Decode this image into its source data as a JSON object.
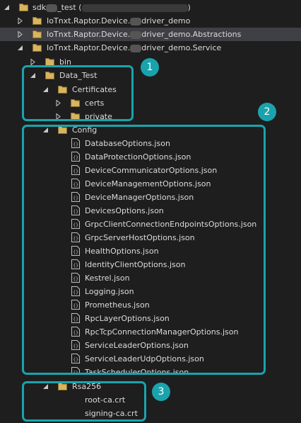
{
  "root": {
    "label_prefix": "sdk",
    "label_mid": "_test (",
    "label_end": ")"
  },
  "projects": [
    {
      "label_start": "IoTnxt.Raptor.Device.",
      "label_end": "driver_demo"
    },
    {
      "label_start": "IoTnxt.Raptor.Device.",
      "label_end": "driver_demo.Abstractions"
    },
    {
      "label_start": "IoTnxt.Raptor.Device.",
      "label_end": "driver_demo.Service"
    }
  ],
  "service_children": {
    "bin": "bin",
    "data_test": "Data_Test",
    "certificates": "Certificates",
    "certs": "certs",
    "private": "private",
    "config": "Config",
    "config_files": [
      "DatabaseOptions.json",
      "DataProtectionOptions.json",
      "DeviceCommunicatorOptions.json",
      "DeviceManagementOptions.json",
      "DeviceManagerOptions.json",
      "DevicesOptions.json",
      "GrpcClientConnectionEndpointsOptions.json",
      "GrpcServerHostOptions.json",
      "HealthOptions.json",
      "IdentityClientOptions.json",
      "Kestrel.json",
      "Logging.json",
      "Prometheus.json",
      "RpcLayerOptions.json",
      "RpcTcpConnectionManagerOptions.json",
      "ServiceLeaderOptions.json",
      "ServiceLeaderUdpOptions.json",
      "TaskSchedulerOptions.json"
    ],
    "rsa256": "Rsa256",
    "rsa_files": [
      "root-ca.crt",
      "signing-ca.crt"
    ]
  },
  "callouts": [
    "1",
    "2",
    "3"
  ],
  "colors": {
    "accent": "#1aa3ad",
    "folder": "#d7b45f",
    "background": "#1e1e1e",
    "selected": "#3f3f46"
  }
}
